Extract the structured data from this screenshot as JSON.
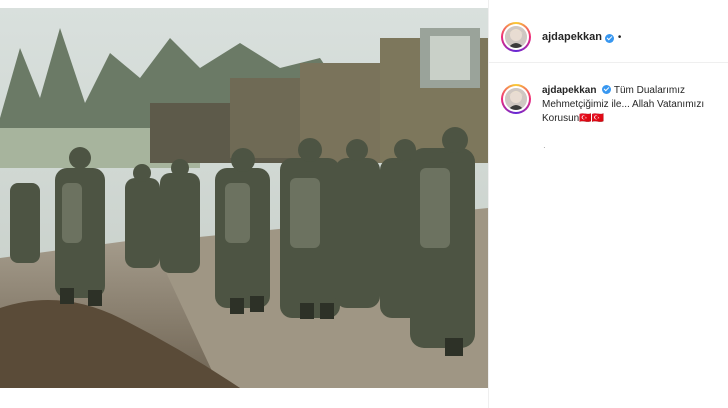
{
  "post": {
    "username": "ajdapekkan",
    "dot": "•",
    "caption_text": "Tüm Dualarımız Mehmetçiğimiz ile... Allah Vatanımızı Korusun🇹🇷🇹🇷",
    "caption_meta": "·"
  },
  "colors": {
    "verified": "#3897f0",
    "text": "#262626",
    "border": "#efefef"
  }
}
